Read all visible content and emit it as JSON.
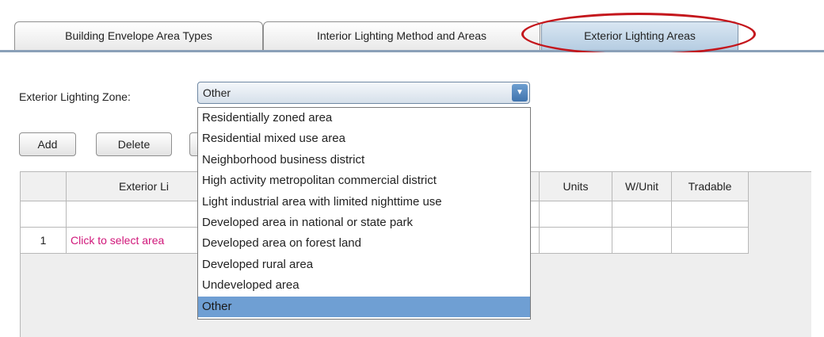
{
  "tabs": [
    {
      "label": "Building Envelope Area Types"
    },
    {
      "label": "Interior Lighting Method and Areas"
    },
    {
      "label": "Exterior Lighting Areas",
      "active": true
    }
  ],
  "zone": {
    "label": "Exterior Lighting Zone:",
    "selected": "Other",
    "options": [
      "Residentially zoned area",
      "Residential mixed use area",
      "Neighborhood business district",
      "High activity metropolitan commercial district",
      "Light industrial area with limited nighttime use",
      "Developed area in national or state park",
      "Developed area on forest land",
      "Developed rural area",
      "Undeveloped area",
      "Other"
    ],
    "selected_index": 9
  },
  "toolbar": {
    "add_label": "Add",
    "delete_label": "Delete"
  },
  "table": {
    "headers": [
      "",
      "Exterior Li",
      "Units",
      "W/Unit",
      "Tradable"
    ],
    "rows": [
      {
        "index": "1",
        "area": "Click to select area"
      }
    ]
  },
  "colors": {
    "annotation_ring": "#c4161c",
    "link_text": "#d0177a",
    "selection": "#6f9fd3"
  }
}
